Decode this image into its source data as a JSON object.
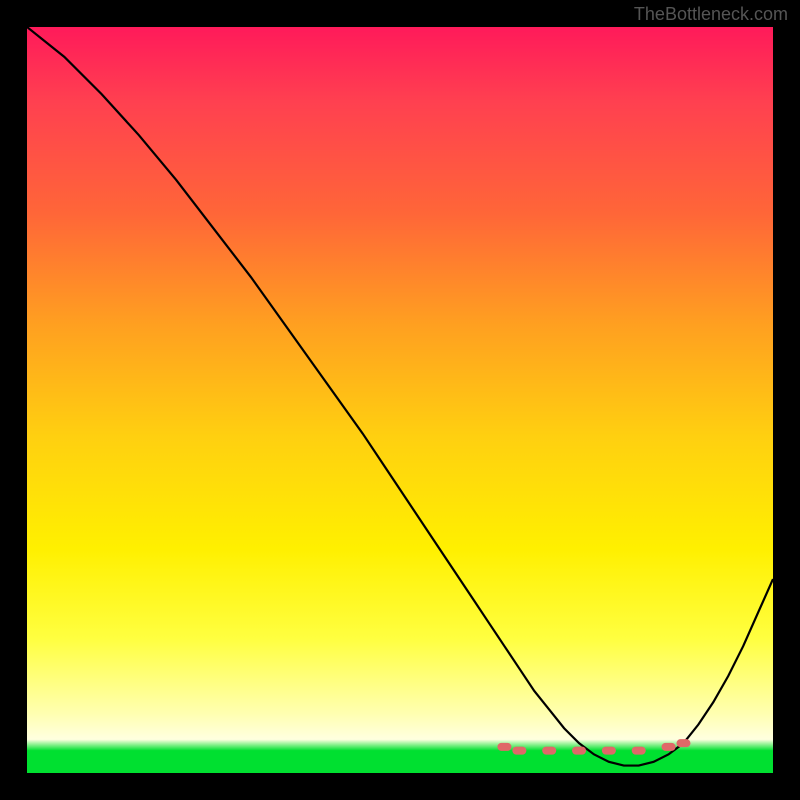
{
  "watermark": "TheBottleneck.com",
  "chart_data": {
    "type": "line",
    "title": "",
    "xlabel": "",
    "ylabel": "",
    "xlim": [
      0,
      100
    ],
    "ylim": [
      0,
      100
    ],
    "series": [
      {
        "name": "bottleneck-curve",
        "x": [
          0,
          5,
          10,
          15,
          20,
          25,
          30,
          35,
          40,
          45,
          50,
          55,
          60,
          62,
          64,
          66,
          68,
          70,
          72,
          74,
          76,
          78,
          80,
          82,
          84,
          86,
          88,
          90,
          92,
          94,
          96,
          98,
          100
        ],
        "y": [
          100,
          96,
          91,
          85.5,
          79.5,
          73,
          66.5,
          59.5,
          52.5,
          45.5,
          38,
          30.5,
          23,
          20,
          17,
          14,
          11,
          8.5,
          6,
          4,
          2.5,
          1.5,
          1,
          1,
          1.5,
          2.5,
          4,
          6.5,
          9.5,
          13,
          17,
          21.5,
          26
        ]
      }
    ],
    "scatter_points": {
      "name": "optimal-range-markers",
      "x": [
        64,
        66,
        70,
        74,
        78,
        82,
        86,
        88
      ],
      "y": [
        3.5,
        3,
        3,
        3,
        3,
        3,
        3.5,
        4
      ]
    },
    "gradient_colors": {
      "top": "#ff1a5a",
      "mid_upper": "#ff6638",
      "mid": "#ffd010",
      "mid_lower": "#ffff40",
      "bottom": "#00e030"
    }
  }
}
